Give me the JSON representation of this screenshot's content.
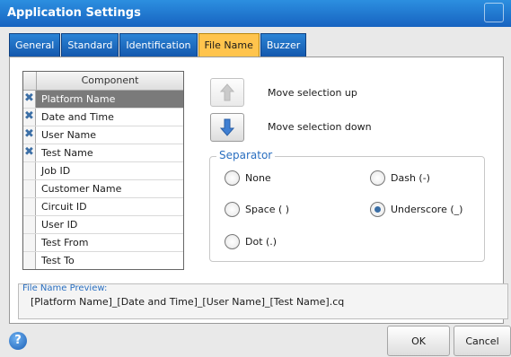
{
  "window": {
    "title": "Application Settings"
  },
  "tabs": [
    {
      "label": "General"
    },
    {
      "label": "Standard"
    },
    {
      "label": "Identification"
    },
    {
      "label": "File Name",
      "active": true
    },
    {
      "label": "Buzzer"
    }
  ],
  "components": {
    "header": "Component",
    "items": [
      {
        "label": "Platform Name",
        "checked": true,
        "selected": true
      },
      {
        "label": "Date and Time",
        "checked": true
      },
      {
        "label": "User Name",
        "checked": true
      },
      {
        "label": "Test Name",
        "checked": true
      },
      {
        "label": "Job ID",
        "checked": false
      },
      {
        "label": "Customer Name",
        "checked": false
      },
      {
        "label": "Circuit ID",
        "checked": false
      },
      {
        "label": "User ID",
        "checked": false
      },
      {
        "label": "Test From",
        "checked": false
      },
      {
        "label": "Test To",
        "checked": false
      }
    ]
  },
  "move": {
    "up_label": "Move selection up",
    "down_label": "Move selection down",
    "up_icon": "arrow-up-icon",
    "down_icon": "arrow-down-icon"
  },
  "separator": {
    "title": "Separator",
    "options": [
      {
        "label": "None",
        "selected": false
      },
      {
        "label": "Dash (-)",
        "selected": false
      },
      {
        "label": "Space ( )",
        "selected": false
      },
      {
        "label": "Underscore (_)",
        "selected": true
      },
      {
        "label": "Dot (.)",
        "selected": false
      }
    ]
  },
  "preview": {
    "label": "File Name Preview:",
    "value": "[Platform Name]_[Date and Time]_[User Name]_[Test Name].cq"
  },
  "footer": {
    "help_icon": "help-icon",
    "ok_label": "OK",
    "cancel_label": "Cancel"
  },
  "colors": {
    "titlebar": "#1b6fd0",
    "active_tab": "#ffc44d",
    "accent_text": "#2a6fc0"
  }
}
